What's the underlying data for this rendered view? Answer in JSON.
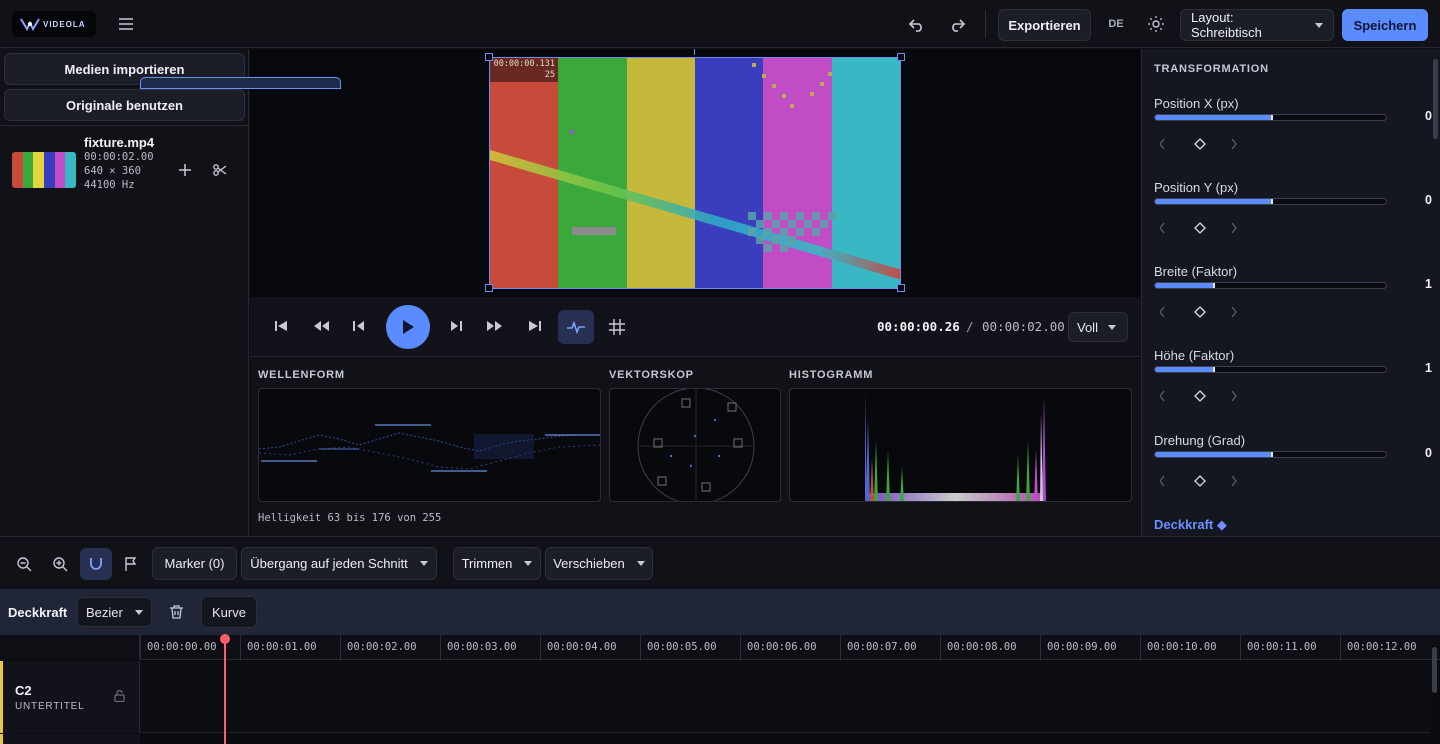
{
  "app": {
    "logo_text": "VIDEOLA",
    "accent_color": "#5b8cff"
  },
  "topbar": {
    "export_label": "Exportieren",
    "language": "DE",
    "layout_select": "Layout: Schreibtisch",
    "save_label": "Speichern",
    "icons": [
      "menu-icon",
      "undo-icon",
      "redo-icon",
      "sun-icon"
    ]
  },
  "media": {
    "import_label": "Medien importieren",
    "originals_label": "Originale benutzen",
    "items": [
      {
        "name": "fixture.mp4",
        "duration": "00:00:02.00",
        "resolution": "640 × 360",
        "samplerate": "44100 Hz"
      }
    ]
  },
  "preview": {
    "overlay_timecode": "00:00:00.131",
    "overlay_frame": "25",
    "bar_colors": [
      "#c84a3b",
      "#3aa83a",
      "#c6b83b",
      "#3b3dbf",
      "#c04dc6",
      "#3ab7c4"
    ]
  },
  "transport": {
    "current_time": "00:00:00.26",
    "separator": "/",
    "total_time": "00:00:02.00",
    "zoom": "Voll"
  },
  "scopes": {
    "waveform_title": "WELLENFORM",
    "vectorscope_title": "VEKTORSKOP",
    "histogram_title": "HISTOGRAMM",
    "info": "Helligkeit 63 bis 176 von 255"
  },
  "inspector": {
    "title": "TRANSFORMATION",
    "props": [
      {
        "label": "Position X (px)",
        "value": "0",
        "level": 0.5
      },
      {
        "label": "Position Y (px)",
        "value": "0",
        "level": 0.5
      },
      {
        "label": "Breite (Faktor)",
        "value": "1",
        "level": 0.25
      },
      {
        "label": "Höhe (Faktor)",
        "value": "1",
        "level": 0.25
      },
      {
        "label": "Drehung (Grad)",
        "value": "0",
        "level": 0.5
      }
    ],
    "opacity_link": "Deckkraft ◆"
  },
  "timeline_toolbar": {
    "markers": "Marker (0)",
    "transition": "Übergang auf jeden Schnitt",
    "trim": "Trimmen",
    "move": "Verschieben"
  },
  "keyframe_bar": {
    "property": "Deckkraft",
    "interpolation": "Bezier",
    "curve": "Kurve"
  },
  "ruler": {
    "ticks": [
      "00:00:00.00",
      "00:00:01.00",
      "00:00:02.00",
      "00:00:03.00",
      "00:00:04.00",
      "00:00:05.00",
      "00:00:06.00",
      "00:00:07.00",
      "00:00:08.00",
      "00:00:09.00",
      "00:00:10.00",
      "00:00:11.00",
      "00:00:12.00"
    ]
  },
  "tracks": [
    {
      "name": "C2",
      "type": "UNTERTITEL"
    }
  ]
}
